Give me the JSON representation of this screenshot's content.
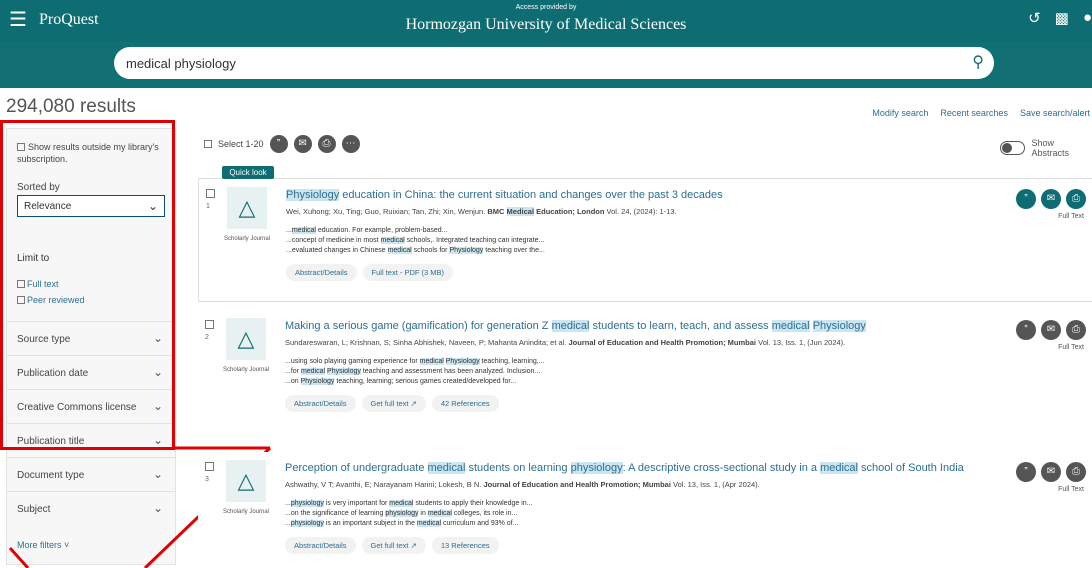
{
  "topbar": {
    "brand": "ProQuest",
    "access_label": "Access provided by",
    "institution": "Hormozgan University of Medical Sciences",
    "icons": [
      "menu-icon",
      "history-icon",
      "folder-icon",
      "user-icon"
    ]
  },
  "search": {
    "query": "medical physiology",
    "icon": "search-icon"
  },
  "results_count": "294,080 results",
  "links": {
    "modify": "Modify search",
    "recent": "Recent searches",
    "save": "Save search/alert"
  },
  "sidebar": {
    "outside": "Show results outside my library's subscription.",
    "sorted_by": "Sorted by",
    "sort_value": "Relevance",
    "limit_to": "Limit to",
    "full_text": "Full text",
    "peer_reviewed": "Peer reviewed",
    "filters": [
      "Source type",
      "Publication date",
      "Creative Commons license",
      "Publication title",
      "Document type",
      "Subject"
    ],
    "more_filters": "More filters ˅"
  },
  "toolbar": {
    "select_label": "Select 1-20",
    "show_abstracts": "Show Abstracts"
  },
  "quick_look": "Quick look",
  "results": [
    {
      "num": "1",
      "doc_type": "Scholarly Journal",
      "title_parts": [
        {
          "t": "Physiology",
          "h": true
        },
        {
          "t": " education in China: the current situation and changes over the past 3 decades",
          "h": false
        }
      ],
      "meta_parts": [
        {
          "t": "Wei, Xuhong; Xu, Ting; Guo, Ruixian; Tan, Zhi; Xin, Wenjun.  ",
          "b": false,
          "h": false
        },
        {
          "t": "BMC ",
          "b": true,
          "h": false
        },
        {
          "t": "Medical",
          "b": true,
          "h": true
        },
        {
          "t": " Education; London",
          "b": true,
          "h": false
        },
        {
          "t": " Vol. 24,  (2024): 1-13.",
          "b": false,
          "h": false
        }
      ],
      "snippets": [
        [
          {
            "t": "...",
            "h": false
          },
          {
            "t": "medical",
            "h": true
          },
          {
            "t": " education. For example, problem-based...",
            "h": false
          }
        ],
        [
          {
            "t": "...concept of medicine in most ",
            "h": false
          },
          {
            "t": "medical",
            "h": true
          },
          {
            "t": " schools,. Integrated teaching can integrate...",
            "h": false
          }
        ],
        [
          {
            "t": "...evaluated changes in Chinese ",
            "h": false
          },
          {
            "t": "medical",
            "h": true
          },
          {
            "t": " schools for ",
            "h": false
          },
          {
            "t": "Physiology",
            "h": true
          },
          {
            "t": " teaching over the...",
            "h": false
          }
        ]
      ],
      "actions": [
        "Abstract/Details",
        "Full text - PDF (3 MB)"
      ],
      "full_text_label": "Full Text"
    },
    {
      "num": "2",
      "doc_type": "Scholarly Journal",
      "title_parts": [
        {
          "t": "Making a serious game (gamification) for generation Z ",
          "h": false
        },
        {
          "t": "medical",
          "h": true
        },
        {
          "t": " students to learn, teach, and assess ",
          "h": false
        },
        {
          "t": "medical",
          "h": true
        },
        {
          "t": " ",
          "h": false
        },
        {
          "t": "Physiology",
          "h": true
        }
      ],
      "meta_parts": [
        {
          "t": "Sundareswaran, L; Krishnan, S; Sinha Abhishek, Naveen, P; Mahanta Anindita; et al.  ",
          "b": false,
          "h": false
        },
        {
          "t": "Journal of Education and Health Promotion; Mumbai",
          "b": true,
          "h": false
        },
        {
          "t": " Vol. 13, Iss. 1,  (Jun 2024).",
          "b": false,
          "h": false
        }
      ],
      "snippets": [
        [
          {
            "t": "...using solo playing gaming experience for ",
            "h": false
          },
          {
            "t": "medical",
            "h": true
          },
          {
            "t": " ",
            "h": false
          },
          {
            "t": "Physiology",
            "h": true
          },
          {
            "t": " teaching, learning,...",
            "h": false
          }
        ],
        [
          {
            "t": "...for ",
            "h": false
          },
          {
            "t": "medical",
            "h": true
          },
          {
            "t": " ",
            "h": false
          },
          {
            "t": "Physiology",
            "h": true
          },
          {
            "t": " teaching and assessment has been analyzed. Inclusion...",
            "h": false
          }
        ],
        [
          {
            "t": "...on ",
            "h": false
          },
          {
            "t": "Physiology",
            "h": true
          },
          {
            "t": " teaching, learning; serious games created/developed for...",
            "h": false
          }
        ]
      ],
      "actions": [
        "Abstract/Details",
        "Get full text ↗",
        "42 References"
      ],
      "full_text_label": "Full Text"
    },
    {
      "num": "3",
      "doc_type": "Scholarly Journal",
      "title_parts": [
        {
          "t": "Perception of undergraduate ",
          "h": false
        },
        {
          "t": "medical",
          "h": true
        },
        {
          "t": " students on learning ",
          "h": false
        },
        {
          "t": "physiology",
          "h": true
        },
        {
          "t": ": A descriptive cross-sectional study in a ",
          "h": false
        },
        {
          "t": "medical",
          "h": true
        },
        {
          "t": " school of South India",
          "h": false
        }
      ],
      "meta_parts": [
        {
          "t": "Ashwathy, V T; Avanthi, E; Narayanam Harini; Lokesh, B N.  ",
          "b": false,
          "h": false
        },
        {
          "t": "Journal of Education and Health Promotion; Mumbai",
          "b": true,
          "h": false
        },
        {
          "t": " Vol. 13, Iss. 1,  (Apr 2024).",
          "b": false,
          "h": false
        }
      ],
      "snippets": [
        [
          {
            "t": "...",
            "h": false
          },
          {
            "t": "physiology",
            "h": true
          },
          {
            "t": " is very important for ",
            "h": false
          },
          {
            "t": "medical",
            "h": true
          },
          {
            "t": " students to apply their knowledge in...",
            "h": false
          }
        ],
        [
          {
            "t": "...on the significance of learning ",
            "h": false
          },
          {
            "t": "physiology",
            "h": true
          },
          {
            "t": " in ",
            "h": false
          },
          {
            "t": "medical",
            "h": true
          },
          {
            "t": " colleges, its role in...",
            "h": false
          }
        ],
        [
          {
            "t": "...",
            "h": false
          },
          {
            "t": "physiology",
            "h": true
          },
          {
            "t": " is an important subject in the ",
            "h": false
          },
          {
            "t": "medical",
            "h": true
          },
          {
            "t": " curriculum and 93% of...",
            "h": false
          }
        ]
      ],
      "actions": [
        "Abstract/Details",
        "Get full text ↗",
        "13 References"
      ],
      "full_text_label": "Full Text"
    }
  ]
}
